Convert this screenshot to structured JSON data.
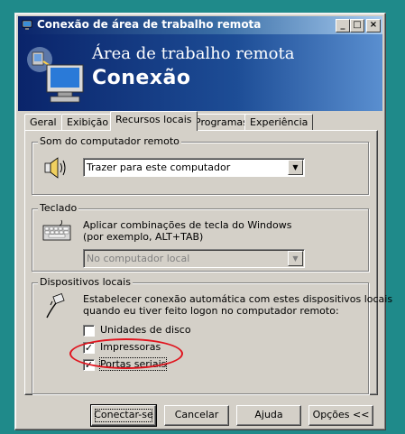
{
  "window": {
    "title": "Conexão de área de trabalho remota",
    "controls": {
      "minimize": "_",
      "maximize": "□",
      "close": "×"
    }
  },
  "banner": {
    "subtitle": "Área de trabalho remota",
    "title": "Conexão"
  },
  "tabs": [
    {
      "label": "Geral",
      "active": false
    },
    {
      "label": "Exibição",
      "active": false
    },
    {
      "label": "Recursos locais",
      "active": true
    },
    {
      "label": "Programas",
      "active": false
    },
    {
      "label": "Experiência",
      "active": false
    }
  ],
  "sound_group": {
    "legend": "Som do computador remoto",
    "icon": "speaker-icon",
    "combo_value": "Trazer para este computador"
  },
  "keyboard_group": {
    "legend": "Teclado",
    "icon": "keyboard-icon",
    "description_line1": "Aplicar combinações de tecla do Windows",
    "description_line2": "(por exemplo, ALT+TAB)",
    "combo_value": "No computador local",
    "combo_disabled": true
  },
  "devices_group": {
    "legend": "Dispositivos locais",
    "icon": "plug-icon",
    "description_line1": "Estabelecer conexão automática com estes dispositivos locais",
    "description_line2": "quando eu tiver feito logon no computador remoto:",
    "options": [
      {
        "label": "Unidades de disco",
        "checked": false
      },
      {
        "label": "Impressoras",
        "checked": true
      },
      {
        "label": "Portas seriais",
        "checked": true
      }
    ]
  },
  "buttons": {
    "connect": "Conectar-se",
    "cancel": "Cancelar",
    "help": "Ajuda",
    "options": "Opções <<"
  },
  "colors": {
    "desktop": "#1f8a8a",
    "title_gradient_start": "#0a246a",
    "highlight_ellipse": "#e0141e"
  }
}
